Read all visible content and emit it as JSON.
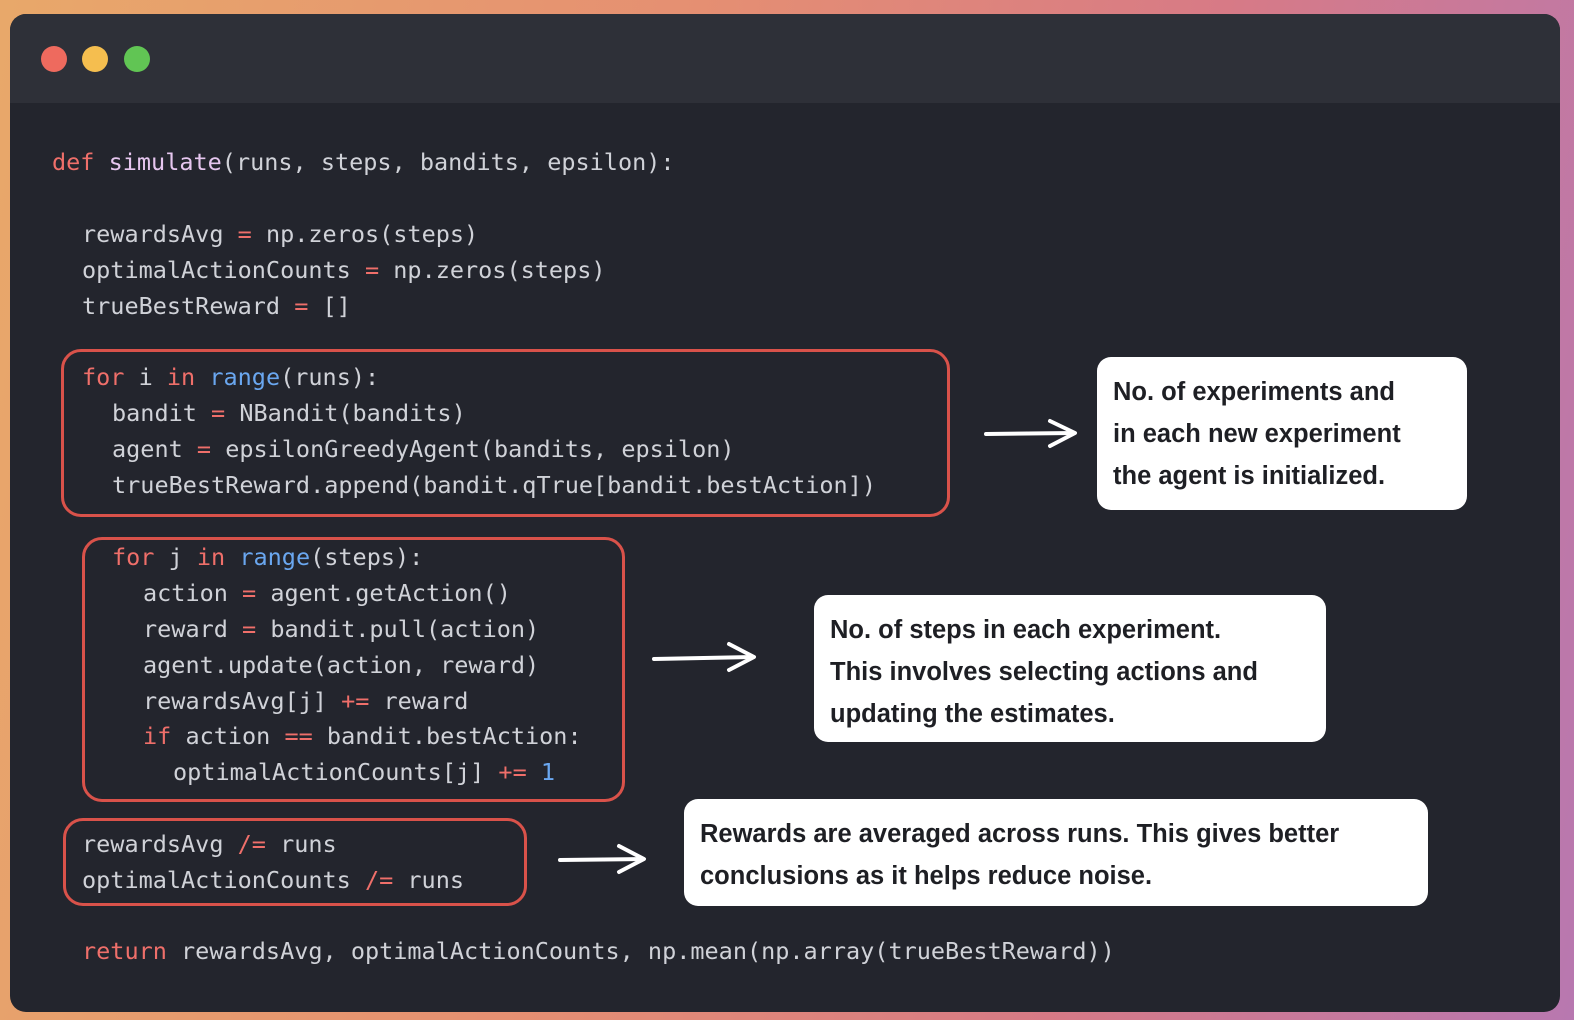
{
  "window": {
    "controls": [
      "close",
      "minimize",
      "zoom"
    ]
  },
  "code": {
    "l1": {
      "kw": "def",
      "fn": "simulate",
      "rest": "(runs, steps, bandits, epsilon):"
    },
    "l2": {
      "a": "rewardsAvg ",
      "op": "=",
      "b": " np.zeros(steps)"
    },
    "l3": {
      "a": "optimalActionCounts ",
      "op": "=",
      "b": " np.zeros(steps)"
    },
    "l4": {
      "a": "trueBestReward ",
      "op": "=",
      "b": " []"
    },
    "l5": {
      "kw1": "for",
      "a": " i ",
      "kw2": "in",
      "b": " ",
      "bi": "range",
      "c": "(runs):"
    },
    "l6": {
      "a": "bandit ",
      "op": "=",
      "b": " NBandit(bandits)"
    },
    "l7": {
      "a": "agent ",
      "op": "=",
      "b": " epsilonGreedyAgent(bandits, epsilon)"
    },
    "l8": {
      "a": "trueBestReward.append(bandit.qTrue[bandit.bestAction])"
    },
    "l9": {
      "kw1": "for",
      "a": " j ",
      "kw2": "in",
      "b": " ",
      "bi": "range",
      "c": "(steps):"
    },
    "l10": {
      "a": "action ",
      "op": "=",
      "b": " agent.getAction()"
    },
    "l11": {
      "a": "reward ",
      "op": "=",
      "b": " bandit.pull(action)"
    },
    "l12": {
      "a": "agent.update(action, reward)"
    },
    "l13": {
      "a": "rewardsAvg[j] ",
      "op": "+=",
      "b": " reward"
    },
    "l14": {
      "kw": "if",
      "a": " action ",
      "op": "==",
      "b": " bandit.bestAction:"
    },
    "l15": {
      "a": "optimalActionCounts[j] ",
      "op": "+=",
      "b": " ",
      "num": "1"
    },
    "l16": {
      "a": "rewardsAvg ",
      "op": "/=",
      "b": " runs"
    },
    "l17": {
      "a": "optimalActionCounts ",
      "op": "/=",
      "b": " runs"
    },
    "l18": {
      "kw": "return",
      "a": " rewardsAvg, optimalActionCounts, np.mean(np.array(trueBestReward))"
    }
  },
  "notes": {
    "n1": [
      "No. of experiments and",
      "in each new experiment",
      "the agent is initialized."
    ],
    "n2": [
      "No. of steps in each experiment.",
      "This involves selecting actions and",
      "updating the estimates."
    ],
    "n3": [
      "Rewards are averaged across runs. This gives better",
      "conclusions as it helps reduce noise."
    ]
  },
  "colors": {
    "keyword": "#ef6f6a",
    "function": "#e6c6ef",
    "builtin": "#6aa7f0",
    "text": "#d0d2d8",
    "highlight_box": "#d9524a",
    "background": "#23252d"
  }
}
